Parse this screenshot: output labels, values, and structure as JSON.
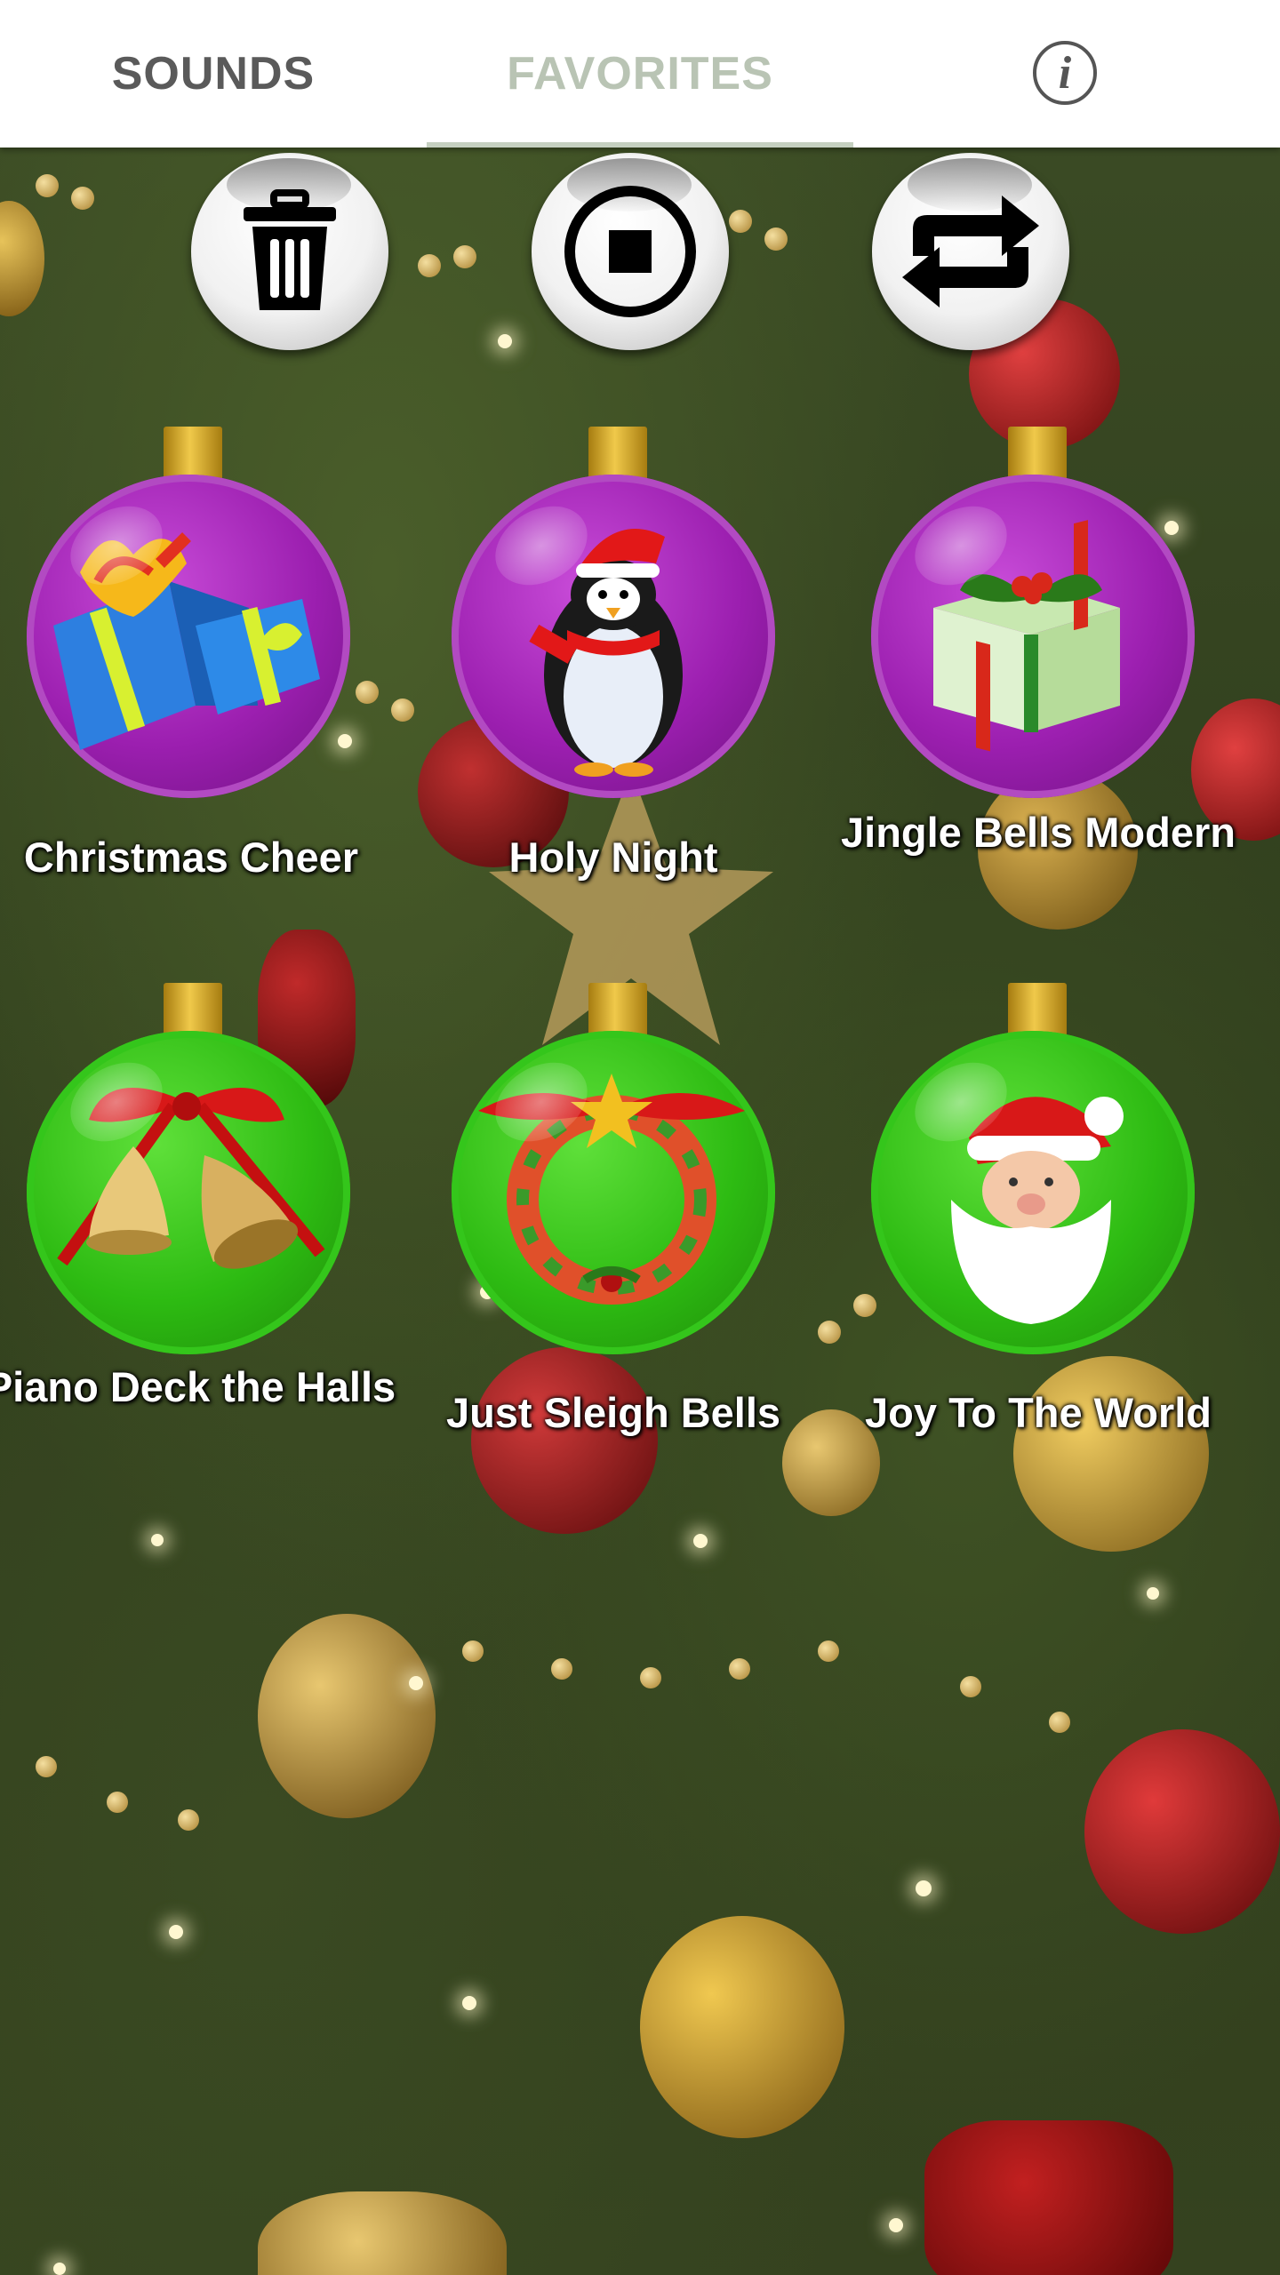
{
  "tabs": [
    {
      "label": "SOUNDS",
      "selected": false
    },
    {
      "label": "FAVORITES",
      "selected": true
    }
  ],
  "info_icon": "info-icon",
  "controls": [
    {
      "name": "delete",
      "icon": "trash-icon"
    },
    {
      "name": "stop",
      "icon": "stop-icon"
    },
    {
      "name": "repeat",
      "icon": "repeat-icon"
    }
  ],
  "sounds": [
    {
      "title": "Christmas Cheer",
      "color": "purple",
      "icon": "gift-boxes-icon"
    },
    {
      "title": "Holy Night",
      "color": "purple",
      "icon": "penguin-icon"
    },
    {
      "title": "Jingle Bells Modern",
      "color": "purple",
      "icon": "present-icon"
    },
    {
      "title": "Piano Deck the Halls",
      "color": "green",
      "icon": "bells-icon"
    },
    {
      "title": "Just Sleigh Bells",
      "color": "green",
      "icon": "wreath-icon"
    },
    {
      "title": "Joy To The World",
      "color": "green",
      "icon": "santa-icon"
    }
  ],
  "colors": {
    "tab_active": "#b9c4b4",
    "tab_inactive": "#5a5a5a",
    "ornament_purple": "#9c1fb0",
    "ornament_green": "#2dbb12"
  }
}
